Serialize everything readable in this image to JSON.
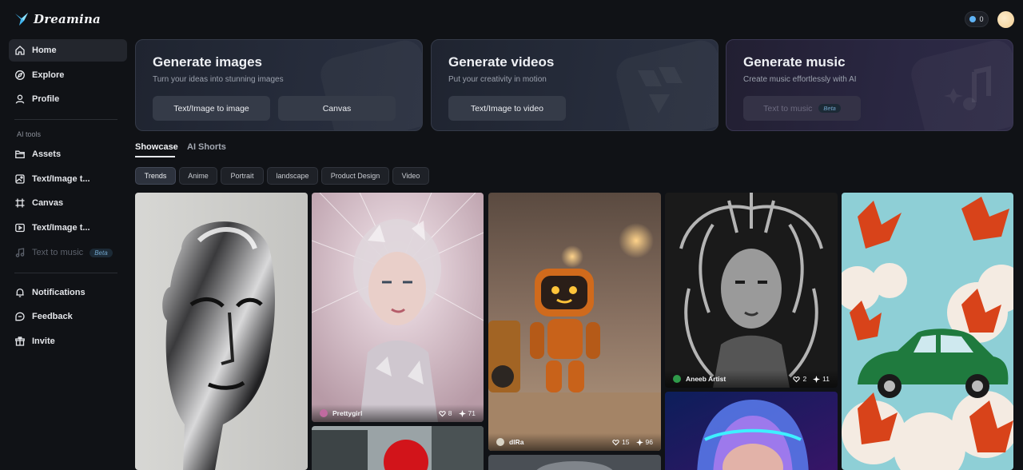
{
  "app": {
    "name": "Dreamina"
  },
  "sidebar": {
    "main": [
      {
        "label": "Home",
        "icon": "home-icon",
        "active": true
      },
      {
        "label": "Explore",
        "icon": "compass-icon"
      },
      {
        "label": "Profile",
        "icon": "user-icon"
      }
    ],
    "ai_tools_label": "AI tools",
    "tools": [
      {
        "label": "Assets",
        "icon": "folder-icon"
      },
      {
        "label": "Text/Image t...",
        "icon": "image-generate-icon"
      },
      {
        "label": "Canvas",
        "icon": "canvas-icon"
      },
      {
        "label": "Text/Image t...",
        "icon": "video-generate-icon"
      },
      {
        "label": "Text to music",
        "icon": "music-note-icon",
        "disabled": true,
        "badge": "Beta"
      }
    ],
    "footer": [
      {
        "label": "Notifications",
        "icon": "bell-icon"
      },
      {
        "label": "Feedback",
        "icon": "chat-bubble-icon"
      },
      {
        "label": "Invite",
        "icon": "gift-icon"
      }
    ]
  },
  "header": {
    "credits": "0"
  },
  "generate_cards": [
    {
      "title": "Generate images",
      "subtitle": "Turn your ideas into stunning images",
      "buttons": [
        {
          "label": "Text/Image to image"
        },
        {
          "label": "Canvas"
        }
      ]
    },
    {
      "title": "Generate videos",
      "subtitle": "Put your creativity in motion",
      "buttons": [
        {
          "label": "Text/Image to video"
        }
      ]
    },
    {
      "title": "Generate music",
      "subtitle": "Create music effortlessly with AI",
      "buttons": [
        {
          "label": "Text to music",
          "badge": "Beta",
          "disabled": true
        }
      ]
    }
  ],
  "tabs": [
    {
      "label": "Showcase",
      "active": true
    },
    {
      "label": "AI Shorts"
    }
  ],
  "filters": [
    {
      "label": "Trends",
      "active": true
    },
    {
      "label": "Anime"
    },
    {
      "label": "Portrait"
    },
    {
      "label": "landscape"
    },
    {
      "label": "Product Design"
    },
    {
      "label": "Video"
    }
  ],
  "gallery": [
    {
      "subject": "chrome mannequin head"
    },
    {
      "subject": "crystal shard woman",
      "user": "Prettygirl",
      "likes": "8",
      "remixes": "71"
    },
    {
      "subject": "orange robot on street",
      "user": "dlRa",
      "likes": "15",
      "remixes": "96"
    },
    {
      "subject": "biomechanical queen",
      "user": "Aneeb Artist",
      "likes": "2",
      "remixes": "11"
    },
    {
      "subject": "green car among maple leaves"
    },
    {
      "subject": "red balloon city"
    },
    {
      "subject": "smoke sculpture"
    },
    {
      "subject": "neon helmet girl"
    }
  ],
  "colors": {
    "background": "#101216",
    "accent": "#5fb3f5",
    "card": "#262c3b"
  }
}
